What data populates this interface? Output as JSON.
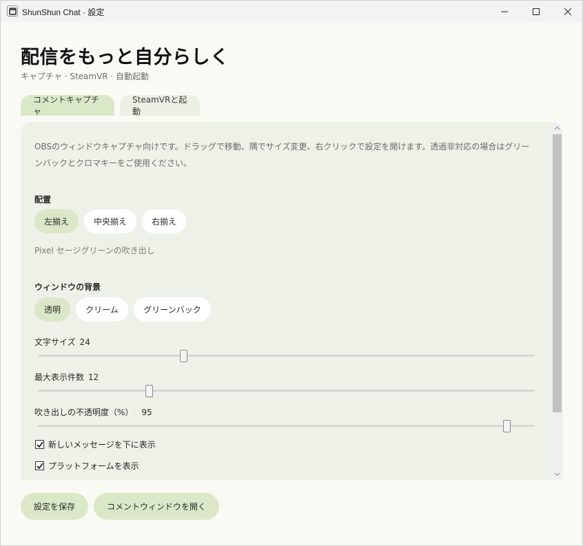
{
  "window": {
    "title": "ShunShun Chat · 設定"
  },
  "header": {
    "title": "配信をもっと自分らしく",
    "subtitle": "キャプチャ · SteamVR · 自動起動"
  },
  "tabs": [
    {
      "label": "コメントキャプチャ",
      "active": true
    },
    {
      "label": "SteamVRと起動",
      "active": false
    }
  ],
  "panel": {
    "description": "OBSのウィンドウキャプチャ向けです。ドラッグで移動、隅でサイズ変更、右クリックで設定を開けます。透過非対応の場合はグリーンバックとクロマキーをご使用ください。",
    "alignment": {
      "label": "配置",
      "options": [
        "左揃え",
        "中央揃え",
        "右揃え"
      ],
      "selected": "左揃え"
    },
    "style_hint": "Pixel セージグリーンの吹き出し",
    "background": {
      "label": "ウィンドウの背景",
      "options": [
        "透明",
        "クリーム",
        "グリーンバック"
      ],
      "selected": "透明"
    },
    "sliders": {
      "font_size": {
        "label": "文字サイズ",
        "value": "24",
        "fraction": 0.29
      },
      "max_items": {
        "label": "最大表示件数",
        "value": "12",
        "fraction": 0.22
      },
      "opacity": {
        "label": "吹き出しの不透明度（%）",
        "value": "95",
        "fraction": 0.95
      }
    },
    "checkboxes": [
      {
        "label": "新しいメッセージを下に表示",
        "checked": true
      },
      {
        "label": "プラットフォームを表示",
        "checked": true
      }
    ]
  },
  "footer": {
    "save_label": "設定を保存",
    "open_label": "コメントウィンドウを開く"
  },
  "colors": {
    "accent": "#dbe8c8",
    "panel_bg": "#eef1e8",
    "page_bg": "#fafaf5"
  }
}
